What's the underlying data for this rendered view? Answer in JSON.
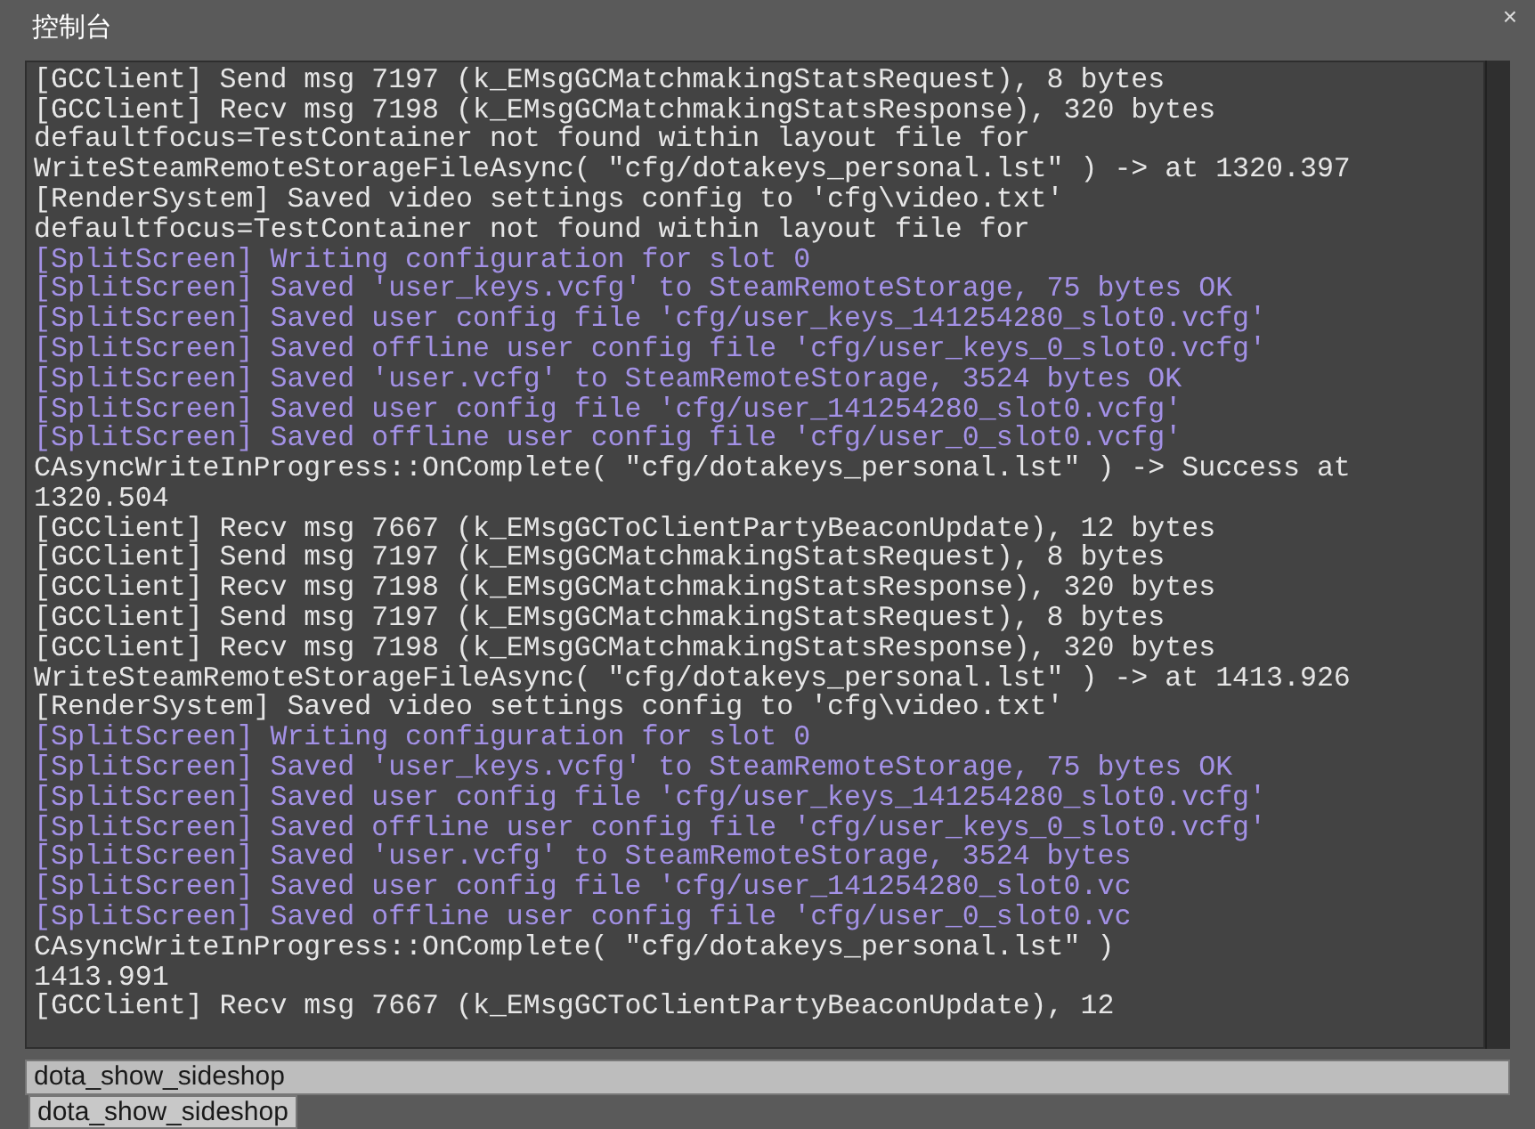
{
  "window": {
    "title": "控制台",
    "close": "×"
  },
  "log": [
    {
      "kind": "info",
      "text": "[GCClient] Send msg 7197 (k_EMsgGCMatchmakingStatsRequest), 8 bytes"
    },
    {
      "kind": "info",
      "text": "[GCClient] Recv msg 7198 (k_EMsgGCMatchmakingStatsResponse), 320 bytes"
    },
    {
      "kind": "info",
      "text": "defaultfocus=TestContainer not found within layout file for"
    },
    {
      "kind": "info",
      "text": "WriteSteamRemoteStorageFileAsync( \"cfg/dotakeys_personal.lst\" ) -> at 1320.397"
    },
    {
      "kind": "info",
      "text": "[RenderSystem] Saved video settings config to 'cfg\\video.txt'"
    },
    {
      "kind": "info",
      "text": "defaultfocus=TestContainer not found within layout file for"
    },
    {
      "kind": "split",
      "text": "[SplitScreen] Writing configuration for slot 0"
    },
    {
      "kind": "split",
      "text": "[SplitScreen] Saved 'user_keys.vcfg' to SteamRemoteStorage, 75 bytes OK"
    },
    {
      "kind": "split",
      "text": "[SplitScreen] Saved user config file 'cfg/user_keys_141254280_slot0.vcfg'"
    },
    {
      "kind": "split",
      "text": "[SplitScreen] Saved offline user config file 'cfg/user_keys_0_slot0.vcfg'"
    },
    {
      "kind": "split",
      "text": "[SplitScreen] Saved 'user.vcfg' to SteamRemoteStorage, 3524 bytes OK"
    },
    {
      "kind": "split",
      "text": "[SplitScreen] Saved user config file 'cfg/user_141254280_slot0.vcfg'"
    },
    {
      "kind": "split",
      "text": "[SplitScreen] Saved offline user config file 'cfg/user_0_slot0.vcfg'"
    },
    {
      "kind": "info",
      "text": "CAsyncWriteInProgress::OnComplete( \"cfg/dotakeys_personal.lst\" ) -> Success at"
    },
    {
      "kind": "info",
      "text": "1320.504"
    },
    {
      "kind": "info",
      "text": "[GCClient] Recv msg 7667 (k_EMsgGCToClientPartyBeaconUpdate), 12 bytes"
    },
    {
      "kind": "info",
      "text": "[GCClient] Send msg 7197 (k_EMsgGCMatchmakingStatsRequest), 8 bytes"
    },
    {
      "kind": "info",
      "text": "[GCClient] Recv msg 7198 (k_EMsgGCMatchmakingStatsResponse), 320 bytes"
    },
    {
      "kind": "info",
      "text": "[GCClient] Send msg 7197 (k_EMsgGCMatchmakingStatsRequest), 8 bytes"
    },
    {
      "kind": "info",
      "text": "[GCClient] Recv msg 7198 (k_EMsgGCMatchmakingStatsResponse), 320 bytes"
    },
    {
      "kind": "info",
      "text": "WriteSteamRemoteStorageFileAsync( \"cfg/dotakeys_personal.lst\" ) -> at 1413.926"
    },
    {
      "kind": "info",
      "text": "[RenderSystem] Saved video settings config to 'cfg\\video.txt'"
    },
    {
      "kind": "split",
      "text": "[SplitScreen] Writing configuration for slot 0"
    },
    {
      "kind": "split",
      "text": "[SplitScreen] Saved 'user_keys.vcfg' to SteamRemoteStorage, 75 bytes OK"
    },
    {
      "kind": "split",
      "text": "[SplitScreen] Saved user config file 'cfg/user_keys_141254280_slot0.vcfg'"
    },
    {
      "kind": "split",
      "text": "[SplitScreen] Saved offline user config file 'cfg/user_keys_0_slot0.vcfg'"
    },
    {
      "kind": "split",
      "text": "[SplitScreen] Saved 'user.vcfg' to SteamRemoteStorage, 3524 bytes"
    },
    {
      "kind": "split",
      "text": "[SplitScreen] Saved user config file 'cfg/user_141254280_slot0.vc"
    },
    {
      "kind": "split",
      "text": "[SplitScreen] Saved offline user config file 'cfg/user_0_slot0.vc"
    },
    {
      "kind": "info",
      "text": "CAsyncWriteInProgress::OnComplete( \"cfg/dotakeys_personal.lst\" )"
    },
    {
      "kind": "info",
      "text": "1413.991"
    },
    {
      "kind": "info",
      "text": "[GCClient] Recv msg 7667 (k_EMsgGCToClientPartyBeaconUpdate), 12"
    }
  ],
  "command": {
    "value": "dota_show_sideshop"
  },
  "suggestions": [
    "dota_show_sideshop"
  ]
}
